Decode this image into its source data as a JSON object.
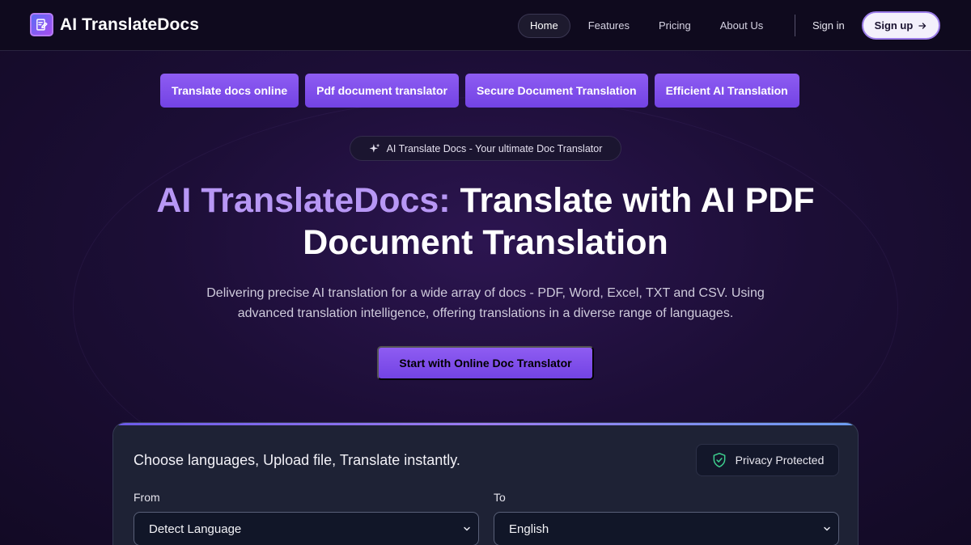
{
  "brand": {
    "name": "AI TranslateDocs",
    "logo_icon": "document-edit-icon"
  },
  "nav": {
    "items": [
      {
        "label": "Home",
        "active": true
      },
      {
        "label": "Features",
        "active": false
      },
      {
        "label": "Pricing",
        "active": false
      },
      {
        "label": "About Us",
        "active": false
      }
    ],
    "signin_label": "Sign in",
    "signup_label": "Sign up",
    "signup_icon": "arrow-right-icon"
  },
  "tags": [
    "Translate docs online",
    "Pdf document translator",
    "Secure Document Translation",
    "Efficient AI Translation"
  ],
  "pill": {
    "icon": "sparkle-icon",
    "text": "AI Translate Docs - Your ultimate Doc Translator"
  },
  "hero": {
    "title_accent": "AI TranslateDocs:",
    "title_line1": " Translate with AI  PDF",
    "title_line2": "Document Translation",
    "desc_line1": "Delivering precise AI translation for a wide array of docs - PDF, Word, Excel, TXT and CSV. Using",
    "desc_line2": "advanced translation intelligence, offering translations in a diverse range of languages.",
    "cta_label": "Start with Online Doc Translator"
  },
  "panel": {
    "title": "Choose languages, Upload file, Translate instantly.",
    "privacy_label": "Privacy Protected",
    "privacy_icon": "shield-check-icon",
    "from_label": "From",
    "from_value": "Detect Language",
    "to_label": "To",
    "to_value": "English"
  },
  "colors": {
    "accent_purple": "#8e5cf2",
    "title_accent": "#b797f5",
    "privacy_green": "#3ecf8e"
  }
}
